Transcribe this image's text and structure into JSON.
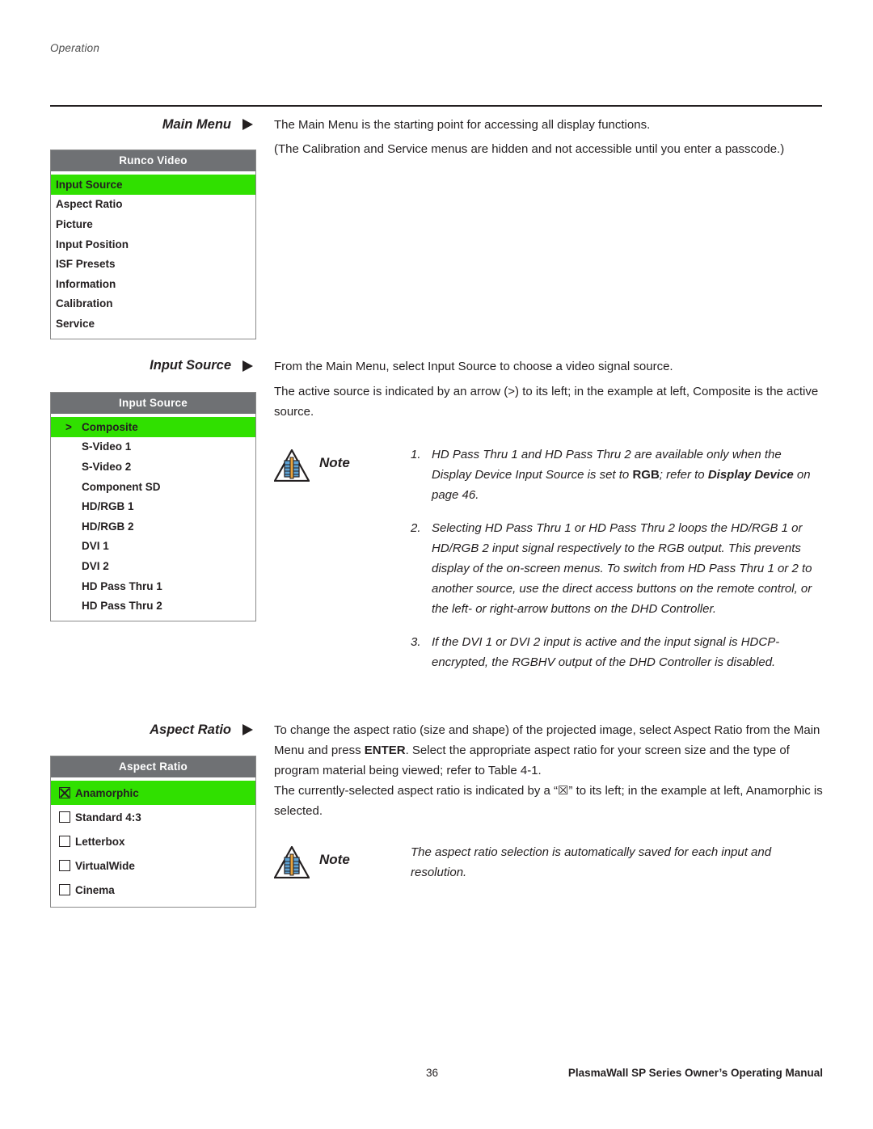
{
  "header": {
    "running_head": "Operation"
  },
  "sections": {
    "main_menu": {
      "label": "Main Menu",
      "paragraphs": [
        "The Main Menu is the starting point for accessing all display functions.",
        "(The Calibration and Service menus are hidden and not accessible until you enter a passcode.)"
      ],
      "osd": {
        "title": "Runco Video",
        "items": [
          {
            "label": "Input Source",
            "highlighted": true
          },
          {
            "label": "Aspect Ratio",
            "highlighted": false
          },
          {
            "label": "Picture",
            "highlighted": false
          },
          {
            "label": "Input Position",
            "highlighted": false
          },
          {
            "label": "ISF Presets",
            "highlighted": false
          },
          {
            "label": "Information",
            "highlighted": false
          },
          {
            "label": "Calibration",
            "highlighted": false
          },
          {
            "label": "Service",
            "highlighted": false
          }
        ]
      }
    },
    "input_source": {
      "label": "Input Source",
      "paragraphs": [
        "From the Main Menu, select Input Source to choose a video signal source.",
        "The active source is indicated by an arrow (>) to its left; in the example at left, Composite is the active source."
      ],
      "osd": {
        "title": "Input Source",
        "items": [
          {
            "marker": ">",
            "label": "Composite",
            "highlighted": true
          },
          {
            "marker": "",
            "label": "S-Video 1",
            "highlighted": false
          },
          {
            "marker": "",
            "label": "S-Video 2",
            "highlighted": false
          },
          {
            "marker": "",
            "label": "Component SD",
            "highlighted": false
          },
          {
            "marker": "",
            "label": "HD/RGB 1",
            "highlighted": false
          },
          {
            "marker": "",
            "label": "HD/RGB 2",
            "highlighted": false
          },
          {
            "marker": "",
            "label": "DVI 1",
            "highlighted": false
          },
          {
            "marker": "",
            "label": "DVI 2",
            "highlighted": false
          },
          {
            "marker": "",
            "label": "HD Pass Thru 1",
            "highlighted": false
          },
          {
            "marker": "",
            "label": "HD Pass Thru 2",
            "highlighted": false
          }
        ]
      },
      "note": {
        "word": "Note",
        "items": [
          {
            "num": "1.",
            "parts": [
              {
                "text": "HD Pass Thru 1 and HD Pass Thru 2 are available only when the Display Device Input Source is set to ",
                "style": "italic"
              },
              {
                "text": "RGB",
                "style": "bold"
              },
              {
                "text": "; refer to ",
                "style": "italic"
              },
              {
                "text": "Display Device",
                "style": "bold-italic"
              },
              {
                "text": " on page 46.",
                "style": "italic"
              }
            ]
          },
          {
            "num": "2.",
            "parts": [
              {
                "text": "Selecting HD Pass Thru 1 or HD Pass Thru 2 loops the HD/RGB 1 or HD/RGB 2 input signal respectively to the RGB output. This prevents display of the on-screen menus. To switch from HD Pass Thru 1 or 2 to another source, use the direct access buttons on the remote control, or the left- or right-arrow buttons on the DHD Controller.",
                "style": "italic"
              }
            ]
          },
          {
            "num": "3.",
            "parts": [
              {
                "text": "If the DVI 1 or DVI 2 input is active and the input signal is HDCP-encrypted, the RGBHV output of the DHD Controller is disabled.",
                "style": "italic"
              }
            ]
          }
        ]
      }
    },
    "aspect_ratio": {
      "label": "Aspect Ratio",
      "paragraphs": [
        "To change the aspect ratio (size and shape) of the projected image, select Aspect Ratio from the Main Menu and press ENTER. Select the appropriate aspect ratio for your screen size and the type of program material being viewed; refer to Table 4-1.",
        "The currently-selected aspect ratio is indicated by a “☒” to its left; in the example at left, Anamorphic is selected."
      ],
      "enter_word": "ENTER",
      "osd": {
        "title": "Aspect Ratio",
        "items": [
          {
            "checked": true,
            "label": "Anamorphic",
            "highlighted": true
          },
          {
            "checked": false,
            "label": "Standard 4:3",
            "highlighted": false
          },
          {
            "checked": false,
            "label": "Letterbox",
            "highlighted": false
          },
          {
            "checked": false,
            "label": "VirtualWide",
            "highlighted": false
          },
          {
            "checked": false,
            "label": "Cinema",
            "highlighted": false
          }
        ]
      },
      "note": {
        "word": "Note",
        "text": "The aspect ratio selection is automatically saved for each input and resolution."
      }
    }
  },
  "footer": {
    "page_number": "36",
    "manual_title": "PlasmaWall SP Series Owner’s Operating Manual"
  },
  "colors": {
    "highlight_green": "#30e000",
    "osd_title_gray": "#6f7174",
    "text": "#231f20"
  }
}
